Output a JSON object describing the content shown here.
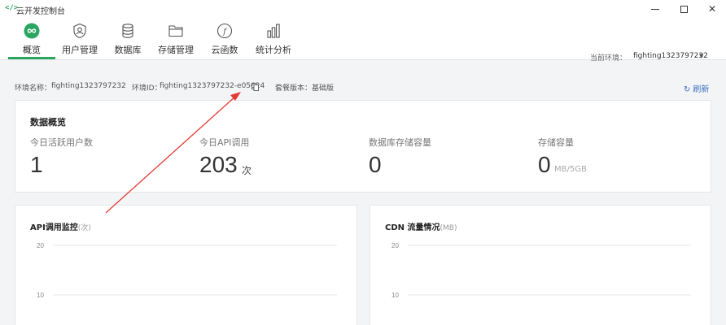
{
  "app": {
    "title": "云开发控制台",
    "icon": "code-icon"
  },
  "nav": {
    "items": [
      {
        "label": "概览",
        "icon": "infinity-icon",
        "active": true
      },
      {
        "label": "用户管理",
        "icon": "user-shield-icon"
      },
      {
        "label": "数据库",
        "icon": "database-icon"
      },
      {
        "label": "存储管理",
        "icon": "folder-icon"
      },
      {
        "label": "云函数",
        "icon": "function-icon"
      },
      {
        "label": "统计分析",
        "icon": "bar-chart-icon"
      }
    ],
    "env_label": "当前环境：",
    "env_value": "fighting1323797232"
  },
  "info": {
    "env_name_label": "环境名称：",
    "env_name": "fighting1323797232",
    "env_id_label": "环境ID：",
    "env_id": "fighting1323797232-e05624",
    "plan_label": "套餐版本：",
    "plan": "基础版",
    "refresh_label": "刷新"
  },
  "overview": {
    "title": "数据概览",
    "stats": [
      {
        "label": "今日活跃用户数",
        "value": "1",
        "unit": ""
      },
      {
        "label": "今日API调用",
        "value": "203",
        "unit": "次"
      },
      {
        "label": "数据库存储容量",
        "value": "0",
        "unit": ""
      },
      {
        "label": "存储容量",
        "value": "0",
        "unit": "MB/5GB"
      }
    ]
  },
  "charts": {
    "api": {
      "title": "API调用监控",
      "unit": "(次)",
      "ticks": [
        "20",
        "10"
      ]
    },
    "cdn": {
      "title": "CDN 流量情况",
      "unit": "(MB)",
      "ticks": [
        "20",
        "10"
      ]
    }
  },
  "colors": {
    "accent": "#2aa660",
    "link": "#3a6fbf",
    "annotation": "#e53935"
  }
}
